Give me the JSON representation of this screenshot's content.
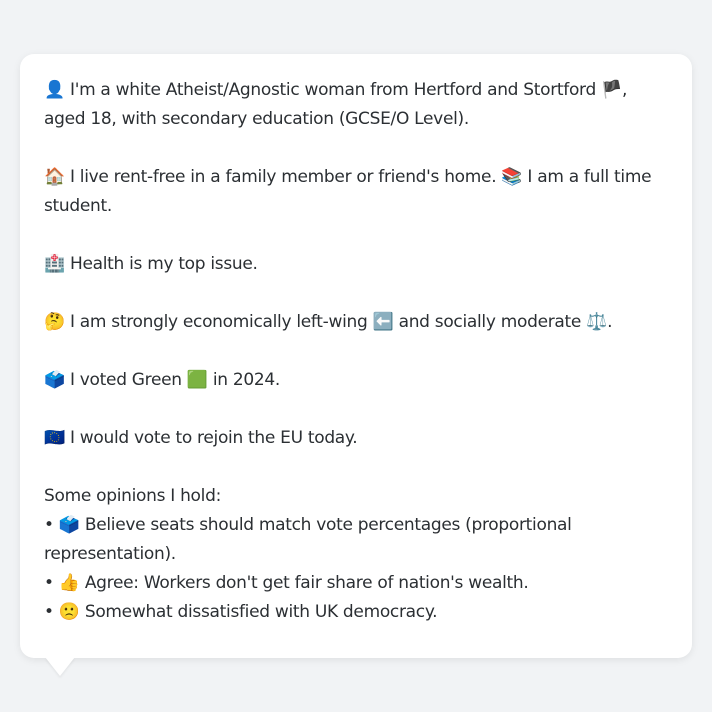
{
  "profile": {
    "identity": {
      "icon": "👤",
      "text_before_flag": "I'm a white Atheist/Agnostic woman from Hertford and Stortford",
      "flag": "🏴",
      "text_after_flag": ", aged 18, with secondary education (GCSE/O Level)."
    },
    "housing": {
      "icon": "🏠",
      "text": "I live rent-free in a family member or friend's home.",
      "icon2": "📚",
      "text2": "I am a full time student."
    },
    "top_issue": {
      "icon": "🏥",
      "text": "Health is my top issue."
    },
    "politics": {
      "icon": "🤔",
      "text": "I am strongly economically left-wing",
      "icon2": "⬅️",
      "text2": "and socially moderate",
      "icon3": "⚖️",
      "text3": "."
    },
    "vote": {
      "icon": "🗳️",
      "text": "I voted Green",
      "icon2": "🟩",
      "text2": "in 2024."
    },
    "eu": {
      "icon": "🇪🇺",
      "text": "I would vote to rejoin the EU today."
    },
    "opinions": {
      "heading": "Some opinions I hold:",
      "items": [
        {
          "bullet": "•",
          "icon": "🗳️",
          "text": "Believe seats should match vote percentages (proportional representation)."
        },
        {
          "bullet": "•",
          "icon": "👍",
          "text": "Agree: Workers don't get fair share of nation's wealth."
        },
        {
          "bullet": "•",
          "icon": "🙁",
          "text": "Somewhat dissatisfied with UK democracy."
        }
      ]
    }
  }
}
